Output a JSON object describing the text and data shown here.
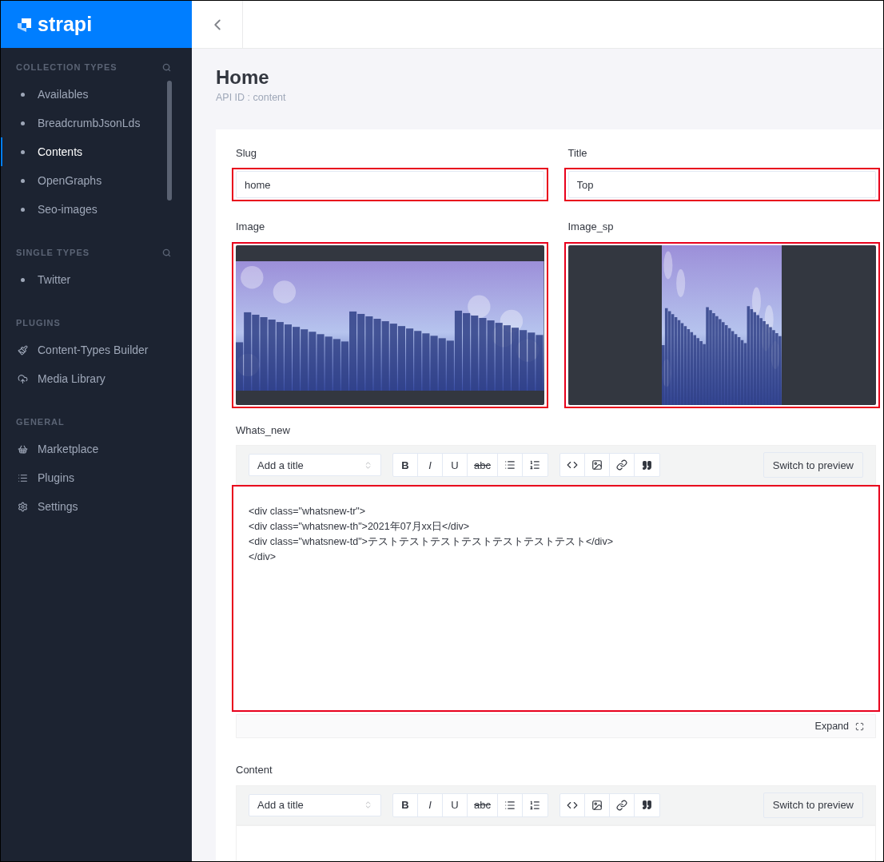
{
  "brand": {
    "name": "strapi"
  },
  "sidebar": {
    "sections": [
      {
        "heading": "COLLECTION TYPES",
        "searchable": true,
        "items": [
          {
            "label": "Availables",
            "kind": "dot",
            "selected": false
          },
          {
            "label": "BreadcrumbJsonLds",
            "kind": "dot",
            "selected": false
          },
          {
            "label": "Contents",
            "kind": "dot",
            "selected": true
          },
          {
            "label": "OpenGraphs",
            "kind": "dot",
            "selected": false
          },
          {
            "label": "Seo-images",
            "kind": "dot",
            "selected": false
          }
        ]
      },
      {
        "heading": "SINGLE TYPES",
        "searchable": true,
        "items": [
          {
            "label": "Twitter",
            "kind": "dot",
            "selected": false
          }
        ]
      },
      {
        "heading": "PLUGINS",
        "searchable": false,
        "items": [
          {
            "label": "Content-Types Builder",
            "kind": "brush",
            "selected": false
          },
          {
            "label": "Media Library",
            "kind": "cloud",
            "selected": false
          }
        ]
      },
      {
        "heading": "GENERAL",
        "searchable": false,
        "items": [
          {
            "label": "Marketplace",
            "kind": "basket",
            "selected": false
          },
          {
            "label": "Plugins",
            "kind": "list",
            "selected": false
          },
          {
            "label": "Settings",
            "kind": "gear",
            "selected": false
          }
        ]
      }
    ]
  },
  "header": {
    "title": "Home",
    "subtitle": "API ID : content"
  },
  "fields": [
    {
      "label": "Slug",
      "value": "home",
      "highlighted": true
    },
    {
      "label": "Title",
      "value": "Top",
      "highlighted": true
    }
  ],
  "media": [
    {
      "label": "Image",
      "kind": "wide",
      "highlighted": true
    },
    {
      "label": "Image_sp",
      "kind": "narrow",
      "highlighted": true
    }
  ],
  "editors": [
    {
      "label": "Whats_new",
      "title_select": "Add a title",
      "preview_button": "Switch to preview",
      "highlighted": true,
      "toolbar": [
        [
          {
            "kind": "bold",
            "label": "B"
          },
          {
            "kind": "italic",
            "label": "I"
          },
          {
            "kind": "underline",
            "label": "U"
          },
          {
            "kind": "strike",
            "label": "abc"
          },
          {
            "kind": "bullet-list"
          },
          {
            "kind": "numbered-list"
          }
        ],
        [
          {
            "kind": "code"
          },
          {
            "kind": "image"
          },
          {
            "kind": "link"
          },
          {
            "kind": "quote"
          }
        ]
      ],
      "lines": [
        "<div class=\"whatsnew-tr\">",
        "<div class=\"whatsnew-th\">2021年07月xx日</div>",
        "<div class=\"whatsnew-td\">テストテストテストテストテストテストテスト</div>",
        "</div>"
      ],
      "footer": "Expand"
    },
    {
      "label": "Content",
      "title_select": "Add a title",
      "preview_button": "Switch to preview",
      "toolbar": [
        [
          {
            "kind": "bold",
            "label": "B"
          },
          {
            "kind": "italic",
            "label": "I"
          },
          {
            "kind": "underline",
            "label": "U"
          },
          {
            "kind": "strike",
            "label": "abc"
          },
          {
            "kind": "bullet-list"
          },
          {
            "kind": "numbered-list"
          }
        ],
        [
          {
            "kind": "code"
          },
          {
            "kind": "image"
          },
          {
            "kind": "link"
          },
          {
            "kind": "quote"
          }
        ]
      ]
    }
  ]
}
